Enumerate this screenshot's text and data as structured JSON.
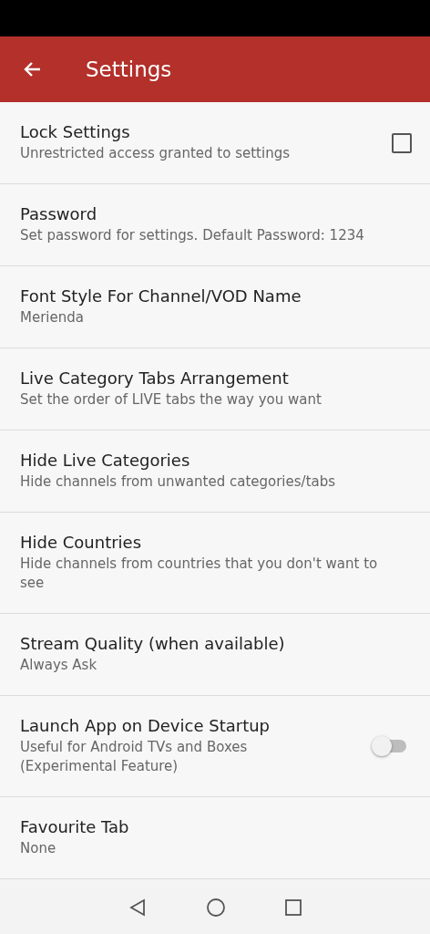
{
  "app_bar": {
    "title": "Settings"
  },
  "settings": [
    {
      "kind": "checkbox",
      "title": "Lock Settings",
      "subtitle": "Unrestricted access granted to settings",
      "checked": false
    },
    {
      "kind": "plain",
      "title": "Password",
      "subtitle": "Set password for settings. Default Password: 1234"
    },
    {
      "kind": "plain",
      "title": "Font Style For Channel/VOD Name",
      "subtitle": "Merienda"
    },
    {
      "kind": "plain",
      "title": "Live Category Tabs Arrangement",
      "subtitle": "Set the order of LIVE tabs the way you want"
    },
    {
      "kind": "plain",
      "title": "Hide Live Categories",
      "subtitle": "Hide channels from unwanted categories/tabs"
    },
    {
      "kind": "plain",
      "title": "Hide Countries",
      "subtitle": "Hide channels from countries that you don't want to see"
    },
    {
      "kind": "plain",
      "title": "Stream Quality (when available)",
      "subtitle": "Always Ask"
    },
    {
      "kind": "switch",
      "title": "Launch App on Device Startup",
      "subtitle": "Useful for Android TVs and Boxes (Experimental Feature)",
      "on": false
    },
    {
      "kind": "plain",
      "title": "Favourite Tab",
      "subtitle": "None"
    }
  ]
}
